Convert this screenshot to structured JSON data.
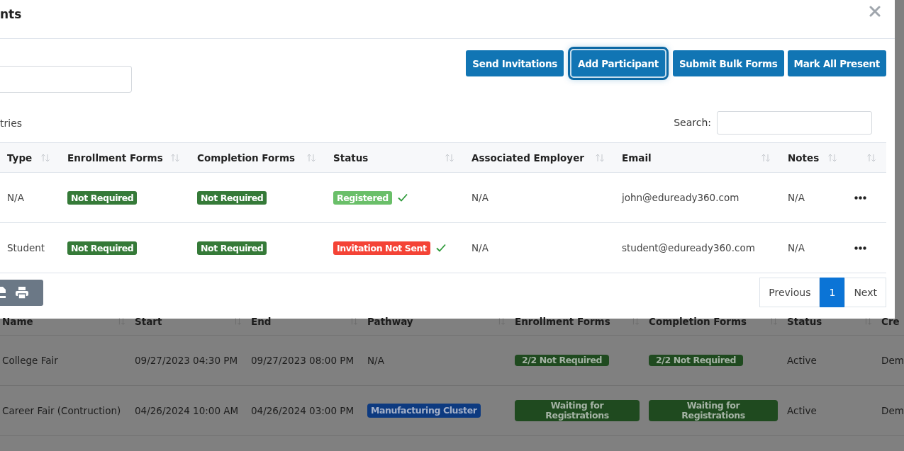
{
  "modal": {
    "title": "nts",
    "toolbar_buttons": [
      {
        "label": "Send Invitations",
        "focused": false
      },
      {
        "label": "Add Participant",
        "focused": true
      },
      {
        "label": "Submit Bulk Forms",
        "focused": false
      },
      {
        "label": "Mark All Present",
        "focused": false
      }
    ],
    "entries_text": "tries",
    "search": {
      "label": "Search:"
    },
    "table": {
      "columns": [
        "Type",
        "Enrollment Forms",
        "Completion Forms",
        "Status",
        "Associated Employer",
        "Email",
        "Notes"
      ],
      "rows": [
        {
          "type": "N/A",
          "enrollment": {
            "text": "Not Required",
            "kind": "success"
          },
          "completion": {
            "text": "Not Required",
            "kind": "success"
          },
          "status": {
            "text": "Registered",
            "kind": "registered",
            "confirmed": true
          },
          "employer": "N/A",
          "email": "john@eduready360.com",
          "notes": "N/A"
        },
        {
          "type": "Student",
          "enrollment": {
            "text": "Not Required",
            "kind": "success"
          },
          "completion": {
            "text": "Not Required",
            "kind": "success"
          },
          "status": {
            "text": "Invitation Not Sent",
            "kind": "danger",
            "confirmed": true
          },
          "employer": "N/A",
          "email": "student@eduready360.com",
          "notes": "N/A"
        }
      ]
    },
    "pagination": {
      "previous": "Previous",
      "pages": [
        {
          "label": "1",
          "selected": true
        }
      ],
      "next": "Next"
    }
  },
  "background_table": {
    "columns": [
      "Name",
      "Start",
      "End",
      "Pathway",
      "Enrollment Forms",
      "Completion Forms",
      "Status",
      "Cre"
    ],
    "rows": [
      {
        "name": "College Fair",
        "start": "09/27/2023 04:30 PM",
        "end": "09/27/2023 08:00 PM",
        "pathway": {
          "text": "N/A",
          "kind": "text"
        },
        "enrollment": "2/2 Not Required",
        "completion": "2/2 Not Required",
        "status": "Active",
        "created": "Dem"
      },
      {
        "name": "Career Fair (Contruction)",
        "start": "04/26/2024 10:00 AM",
        "end": "04/26/2024 03:00 PM",
        "pathway": {
          "text": "Manufacturing Cluster",
          "kind": "tag"
        },
        "enrollment": "Waiting for Registrations",
        "completion": "Waiting for Registrations",
        "status": "Active",
        "created": "Dem"
      }
    ]
  }
}
